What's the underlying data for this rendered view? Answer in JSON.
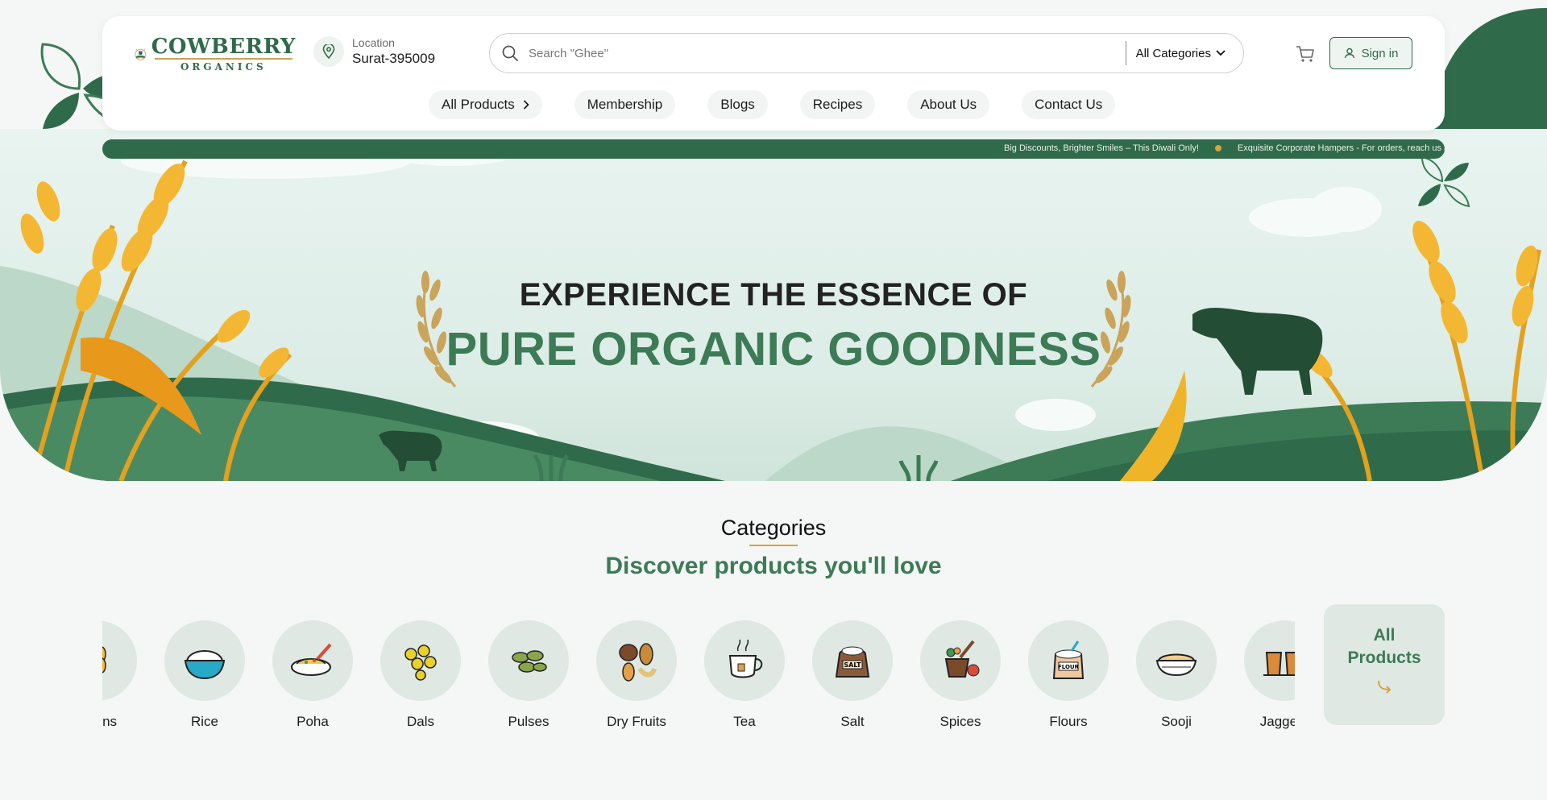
{
  "brand": {
    "name": "COWBERRY",
    "tagline": "ORGANICS"
  },
  "location": {
    "label": "Location",
    "value": "Surat-395009"
  },
  "search": {
    "placeholder": "Search \"Ghee\"",
    "category": "All Categories"
  },
  "auth": {
    "signin_label": "Sign in"
  },
  "nav": {
    "items": [
      {
        "label": "All Products"
      },
      {
        "label": "Membership"
      },
      {
        "label": "Blogs"
      },
      {
        "label": "Recipes"
      },
      {
        "label": "About Us"
      },
      {
        "label": "Contact Us"
      }
    ]
  },
  "ticker": {
    "messages": [
      "Big Discounts, Brighter Smiles – This Diwali Only!",
      "Exquisite Corporate Hampers - For orders, reach us at ou"
    ]
  },
  "hero": {
    "line1": "EXPERIENCE THE ESSENCE OF",
    "line2": "PURE ORGANIC GOODNESS"
  },
  "categories": {
    "title": "Categories",
    "subtitle": "Discover products you'll love",
    "items": [
      {
        "label": "Grains",
        "icon": "grains-icon"
      },
      {
        "label": "Rice",
        "icon": "rice-icon"
      },
      {
        "label": "Poha",
        "icon": "poha-icon"
      },
      {
        "label": "Dals",
        "icon": "dals-icon"
      },
      {
        "label": "Pulses",
        "icon": "pulses-icon"
      },
      {
        "label": "Dry Fruits",
        "icon": "dry-fruits-icon"
      },
      {
        "label": "Tea",
        "icon": "tea-icon"
      },
      {
        "label": "Salt",
        "icon": "salt-icon"
      },
      {
        "label": "Spices",
        "icon": "spices-icon"
      },
      {
        "label": "Flours",
        "icon": "flours-icon"
      },
      {
        "label": "Sooji",
        "icon": "sooji-icon"
      },
      {
        "label": "Jaggery",
        "icon": "jaggery-icon"
      }
    ],
    "all_products_label": "All Products"
  },
  "colors": {
    "brand_green": "#3d7a56",
    "dark_green": "#2f6b4a",
    "accent_gold": "#d9a23c"
  }
}
